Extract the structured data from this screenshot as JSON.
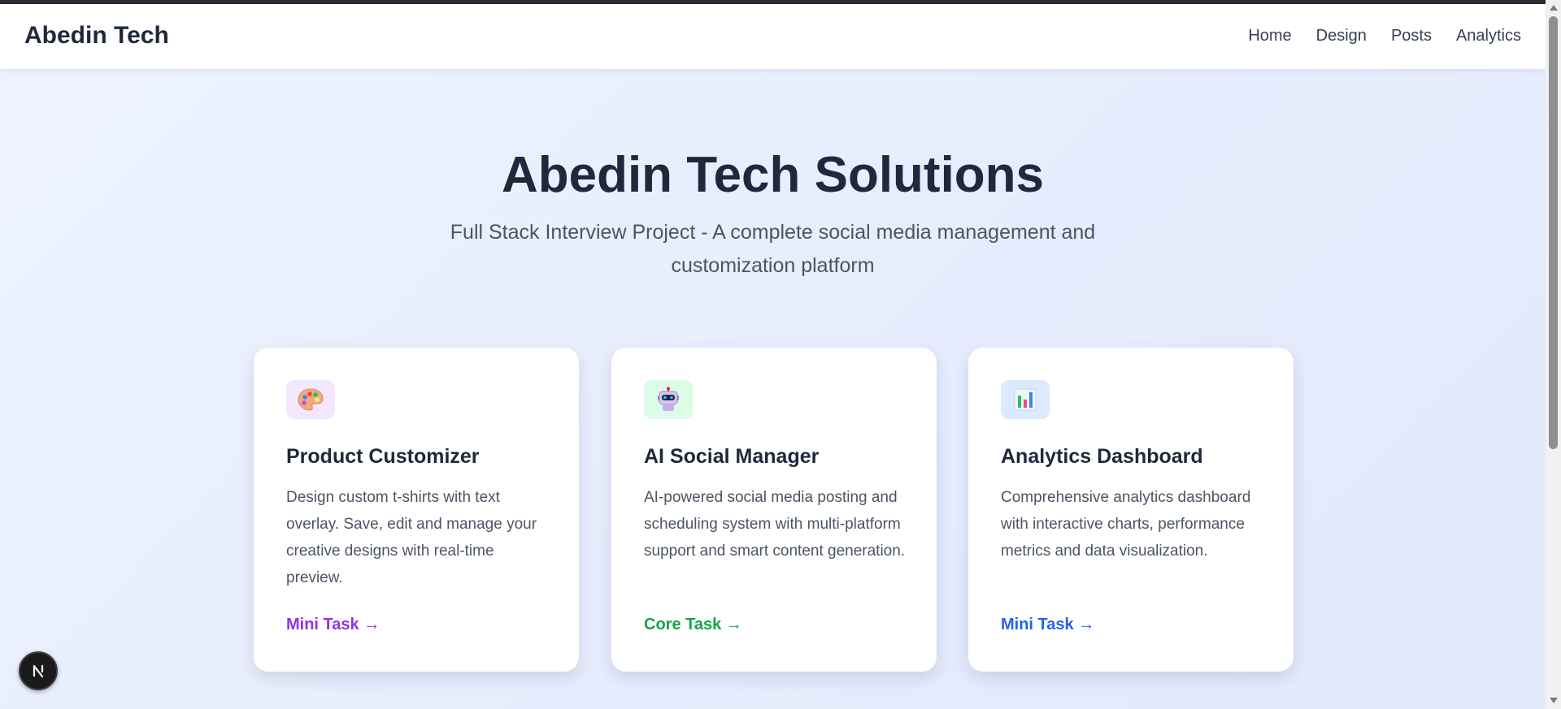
{
  "navbar": {
    "brand": "Abedin Tech",
    "links": [
      {
        "label": "Home"
      },
      {
        "label": "Design"
      },
      {
        "label": "Posts"
      },
      {
        "label": "Analytics"
      }
    ]
  },
  "hero": {
    "title": "Abedin Tech Solutions",
    "subtitle": "Full Stack Interview Project - A complete social media management and customization platform"
  },
  "cards": [
    {
      "icon": "palette-icon",
      "title": "Product Customizer",
      "description": "Design custom t-shirts with text overlay. Save, edit and manage your creative designs with real-time preview.",
      "link_label": "Mini Task →",
      "accent": "#9333ea"
    },
    {
      "icon": "robot-icon",
      "title": "AI Social Manager",
      "description": "AI-powered social media posting and scheduling system with multi-platform support and smart content generation.",
      "link_label": "Core Task →",
      "accent": "#16a34a"
    },
    {
      "icon": "bar-chart-icon",
      "title": "Analytics Dashboard",
      "description": "Comprehensive analytics dashboard with interactive charts, performance metrics and data visualization.",
      "link_label": "Mini Task →",
      "accent": "#2563eb"
    }
  ],
  "dev_badge": {
    "icon": "nextjs-logo-icon",
    "letter": "N"
  },
  "colors": {
    "heading": "#1e293b",
    "body_text": "#4b5563",
    "background": "#e7edfd"
  }
}
